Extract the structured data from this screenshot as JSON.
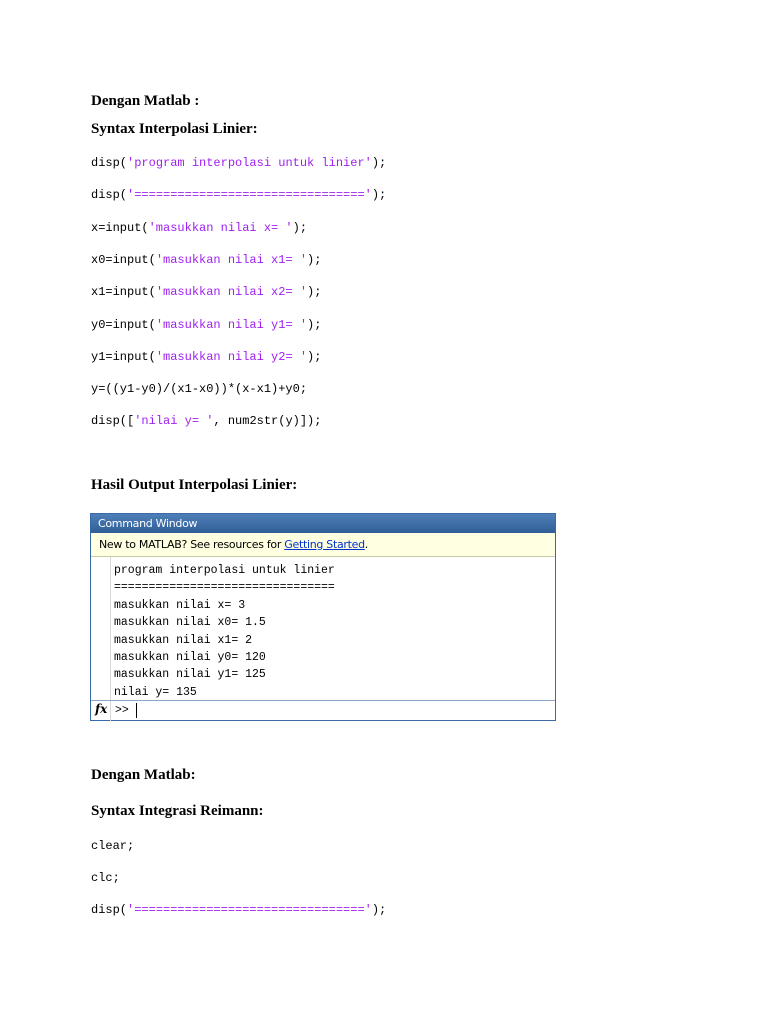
{
  "section1": {
    "heading1": "Dengan Matlab :",
    "heading2": "Syntax Interpolasi Linier:",
    "code": [
      {
        "pre": "disp(",
        "str": "'program interpolasi untuk linier'",
        "post": ");"
      },
      {
        "pre": "disp(",
        "str": "'================================'",
        "post": ");"
      },
      {
        "pre": "x=input(",
        "str": "'masukkan nilai x= '",
        "post": ");"
      },
      {
        "pre": "x0=input(",
        "str": "'masukkan nilai x1= '",
        "post": ");"
      },
      {
        "pre": "x1=input(",
        "str": "'masukkan nilai x2= '",
        "post": ");"
      },
      {
        "pre": "y0=input(",
        "str": "'masukkan nilai y1= '",
        "post": ");"
      },
      {
        "pre": "y1=input(",
        "str": "'masukkan nilai y2= '",
        "post": ");"
      },
      {
        "pre": "y=((y1-y0)/(x1-x0))*(x-x1)+y0;",
        "str": "",
        "post": ""
      },
      {
        "pre": "disp([",
        "str": "'nilai y= '",
        "post": ", num2str(y)]);"
      }
    ]
  },
  "section2": {
    "heading": "Hasil Output Interpolasi Linier:"
  },
  "command_window": {
    "title": "Command Window",
    "info_text": "New to MATLAB? See resources for ",
    "info_link": "Getting Started",
    "info_end": ".",
    "lines": [
      "program interpolasi untuk linier",
      "================================",
      "masukkan nilai x= 3",
      "masukkan nilai x0= 1.5",
      "masukkan nilai x1= 2",
      "masukkan nilai y0= 120",
      "masukkan nilai y1= 125",
      "nilai y= 135"
    ],
    "fx_label": "fx",
    "prompt": ">>"
  },
  "section3": {
    "heading1": "Dengan Matlab:",
    "heading2": "Syntax Integrasi Reimann:",
    "code": [
      {
        "pre": "clear;",
        "str": "",
        "post": ""
      },
      {
        "pre": "clc;",
        "str": "",
        "post": ""
      },
      {
        "pre": "disp(",
        "str": "'================================'",
        "post": ");"
      }
    ]
  }
}
